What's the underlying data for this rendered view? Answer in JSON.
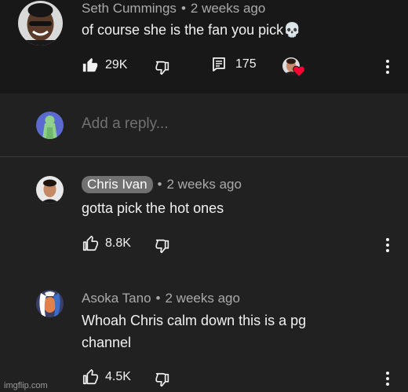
{
  "top_comment": {
    "author": "Seth Cummings",
    "separator": "•",
    "time": "2 weeks ago",
    "text": "of course she is the fan you pick",
    "emoji": "💀",
    "likes": "29K",
    "replies": "175",
    "icons": {
      "like": "thumbs-up-filled-icon",
      "dislike": "thumbs-down-icon",
      "reply": "comment-icon",
      "creator_heart": "creator-heart-icon",
      "more": "more-vert-icon"
    }
  },
  "reply_box": {
    "placeholder": "Add a reply..."
  },
  "replies": [
    {
      "author": "Chris Ivan",
      "author_chip": true,
      "separator": "•",
      "time": "2 weeks ago",
      "text": "gotta pick the hot ones",
      "likes": "8.8K"
    },
    {
      "author": "Asoka Tano",
      "author_chip": false,
      "separator": "•",
      "time": "2 weeks ago",
      "text_line1": "Whoah Chris calm down this is a pg",
      "text_line2": "channel",
      "likes": "4.5K"
    }
  ],
  "watermark": "imgflip.com",
  "colors": {
    "background": "#212121",
    "top_comment_background": "#181818",
    "text": "#f1f1f1",
    "meta": "#aaaaaa",
    "placeholder": "#717171",
    "chip": "#717171",
    "heart": "#ff0033"
  }
}
